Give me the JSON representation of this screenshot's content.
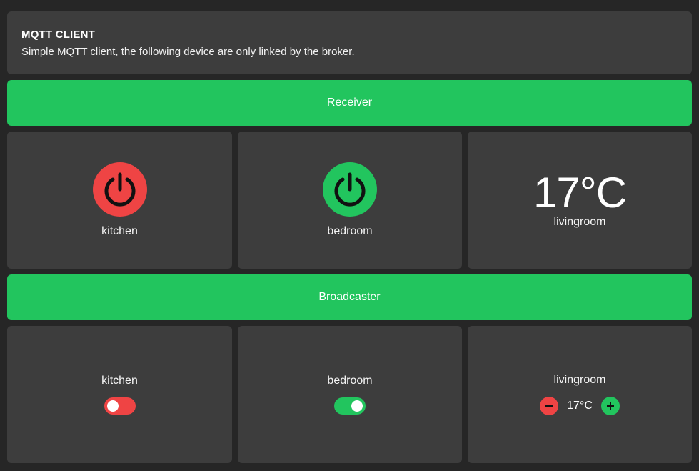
{
  "header": {
    "title": "MQTT CLIENT",
    "description": "Simple MQTT client, the following device are only linked by the broker."
  },
  "receiver": {
    "label": "Receiver",
    "devices": [
      {
        "name": "kitchen",
        "state": "off",
        "color": "#ef4444",
        "icon": "power-icon"
      },
      {
        "name": "bedroom",
        "state": "on",
        "color": "#22c55e",
        "icon": "power-icon"
      },
      {
        "name": "livingroom",
        "temperature": "17°C"
      }
    ]
  },
  "broadcaster": {
    "label": "Broadcaster",
    "devices": [
      {
        "name": "kitchen",
        "state": "off",
        "color": "#ef4444"
      },
      {
        "name": "bedroom",
        "state": "on",
        "color": "#22c55e"
      },
      {
        "name": "livingroom",
        "temperature": "17°C",
        "decrement_icon": "minus-icon",
        "increment_icon": "plus-icon"
      }
    ]
  },
  "colors": {
    "accent": "#22c55e",
    "danger": "#ef4444",
    "card": "#3d3d3d",
    "background": "#262626"
  }
}
